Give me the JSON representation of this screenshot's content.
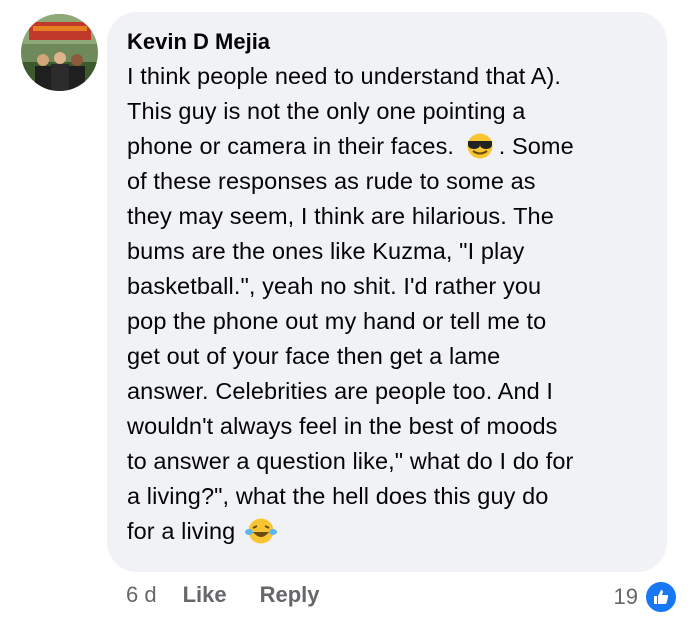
{
  "comment": {
    "author": "Kevin D Mejia",
    "lines": [
      "I think people need to understand that A).",
      "This guy is not the only one pointing a",
      "phone or camera in their faces. ",
      ". Some",
      "of these responses as rude to some as",
      "they may seem, I think are hilarious. The",
      "bums are the ones like Kuzma, \"I play",
      "basketball.\", yeah no shit. I'd rather you",
      "pop the phone out my hand or tell me to",
      "get out of your face then get a lame",
      "answer. Celebrities are people too. And I",
      "wouldn't always feel in the best of moods",
      "to answer a question like,\" what do I do for",
      "a living?\", what the hell does this guy do",
      "for a living "
    ],
    "emoji_1": "sunglasses-emoji",
    "emoji_2": "laughing-tears-emoji"
  },
  "actions": {
    "time": "6 d",
    "like_label": "Like",
    "reply_label": "Reply"
  },
  "reactions": {
    "count": "19",
    "icon": "thumbs-up-icon",
    "color": "#1877f2"
  },
  "colors": {
    "bubble": "#f0f2f5",
    "text": "#050505",
    "muted": "#65676b"
  }
}
